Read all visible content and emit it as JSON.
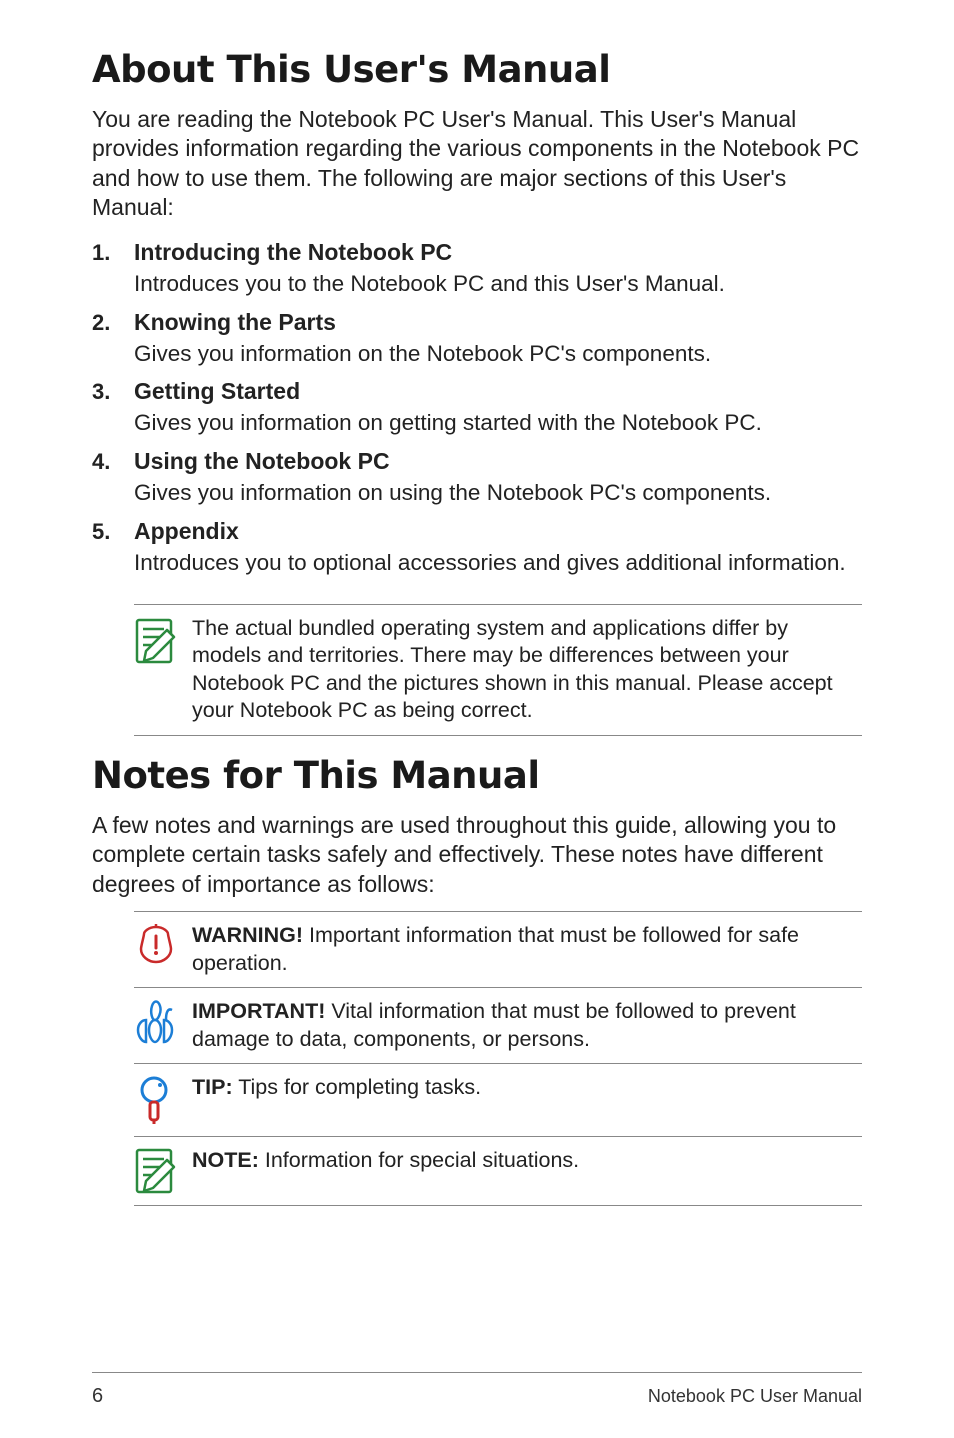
{
  "title1": "About This User's Manual",
  "intro1": "You are reading the Notebook PC User's Manual. This User's Manual provides information regarding the various components in the Notebook PC and how to use them. The following are major sections of this User's Manual:",
  "sections": [
    {
      "num": "1.",
      "title": "Introducing the Notebook PC",
      "desc": "Introduces you to the Notebook PC and this User's Manual."
    },
    {
      "num": "2.",
      "title": "Knowing the Parts",
      "desc": "Gives you information on the Notebook PC's components."
    },
    {
      "num": "3.",
      "title": "Getting Started",
      "desc": "Gives you information on getting started with the Notebook PC."
    },
    {
      "num": "4.",
      "title": "Using the Notebook PC",
      "desc": "Gives you information on using the Notebook PC's components."
    },
    {
      "num": "5.",
      "title": "Appendix",
      "desc": "Introduces you to optional accessories and gives additional information."
    }
  ],
  "sysnote": "The actual bundled operating system and applications differ by models and territories. There may be differences between your Notebook PC and the pictures shown in this manual. Please accept your Notebook PC as being correct.",
  "title2": "Notes for This Manual",
  "intro2": "A few notes and warnings are used throughout this guide, allowing you to complete certain tasks safely and effectively. These notes have different degrees of importance as follows:",
  "callouts": [
    {
      "icon": "warning",
      "label": "WARNING!",
      "text": " Important information that must be followed for safe operation."
    },
    {
      "icon": "important",
      "label": "IMPORTANT!",
      "text": " Vital information that must be followed to prevent damage to data, components, or persons."
    },
    {
      "icon": "tip",
      "label": "TIP:",
      "text": " Tips for completing tasks."
    },
    {
      "icon": "note",
      "label": "NOTE:",
      "text": "  Information for special situations."
    }
  ],
  "footer": {
    "page": "6",
    "doc": "Notebook PC User Manual"
  }
}
